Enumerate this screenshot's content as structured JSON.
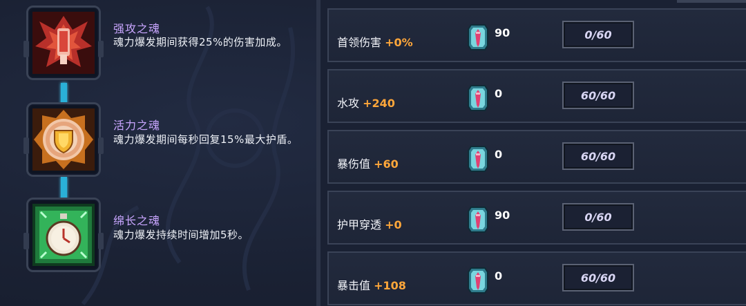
{
  "souls": [
    {
      "name": "强攻之魂",
      "desc": "魂力爆发期间获得25%的伤害加成。",
      "icon": "red-flame-soul-icon",
      "color": "#c23a2a"
    },
    {
      "name": "活力之魂",
      "desc": "魂力爆发期间每秒回复15%最大护盾。",
      "icon": "shield-soul-icon",
      "color": "#e08a22"
    },
    {
      "name": "绵长之魂",
      "desc": "魂力爆发持续时间增加5秒。",
      "icon": "stopwatch-soul-icon",
      "color": "#36b85a"
    }
  ],
  "stats": [
    {
      "label": "首领伤害",
      "bonus": "+0%",
      "cost": "90",
      "level": "0/60"
    },
    {
      "label": "水攻",
      "bonus": "+240",
      "cost": "0",
      "level": "60/60"
    },
    {
      "label": "暴伤值",
      "bonus": "+60",
      "cost": "0",
      "level": "60/60"
    },
    {
      "label": "护甲穿透",
      "bonus": "+0",
      "cost": "90",
      "level": "0/60"
    },
    {
      "label": "暴击值",
      "bonus": "+108",
      "cost": "0",
      "level": "60/60"
    }
  ],
  "colors": {
    "accent_bonus": "#ffa73a",
    "soul_name": "#c9a6ff",
    "connector": "#2ab0d8"
  }
}
